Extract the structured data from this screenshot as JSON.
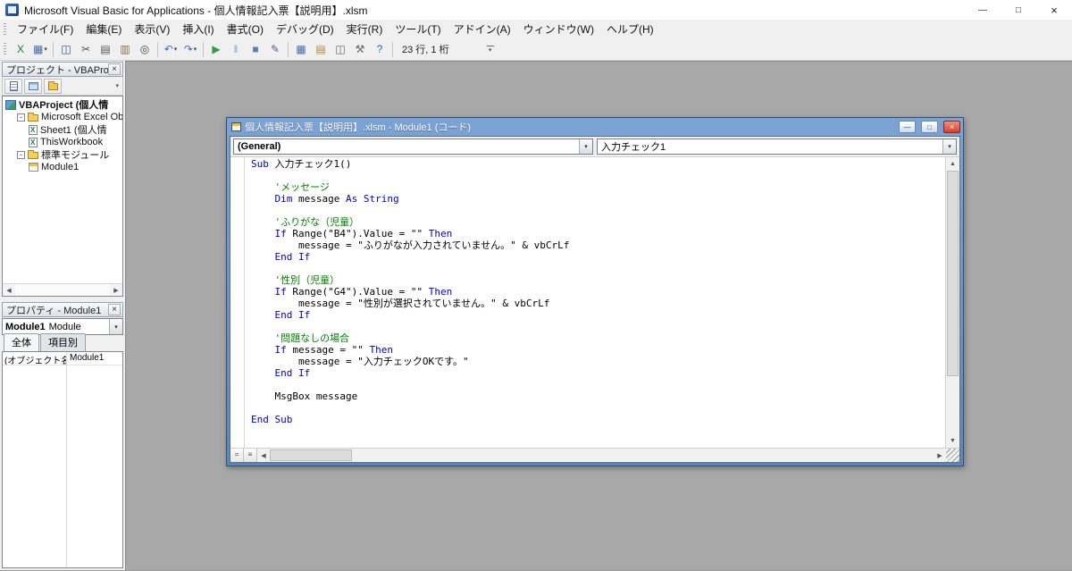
{
  "window": {
    "title": "Microsoft Visual Basic for Applications - 個人情報記入票【説明用】.xlsm"
  },
  "glyphs": {
    "minimize": "—",
    "maximize": "□",
    "close": "×",
    "chevron_down": "▾",
    "up": "▲",
    "down": "▼",
    "left": "◀",
    "right": "▶",
    "proc_view": "=",
    "full_view": "≡"
  },
  "menu": {
    "items": [
      "ファイル(F)",
      "編集(E)",
      "表示(V)",
      "挿入(I)",
      "書式(O)",
      "デバッグ(D)",
      "実行(R)",
      "ツール(T)",
      "アドイン(A)",
      "ウィンドウ(W)",
      "ヘルプ(H)"
    ]
  },
  "toolbar": {
    "buttons": [
      {
        "name": "view-excel-button",
        "glyph": "X",
        "color": "#1a7a3c"
      },
      {
        "name": "insert-userform-button",
        "glyph": "▦",
        "color": "#4a6ea8",
        "dropdown": true
      },
      {
        "sep": true
      },
      {
        "name": "save-button",
        "glyph": "◫",
        "color": "#2d4f8a"
      },
      {
        "name": "cut-button",
        "glyph": "✂",
        "color": "#555555"
      },
      {
        "name": "copy-button",
        "glyph": "▤",
        "color": "#555555"
      },
      {
        "name": "paste-button",
        "glyph": "▥",
        "color": "#8a7040"
      },
      {
        "name": "find-button",
        "glyph": "◎",
        "color": "#444444"
      },
      {
        "sep": true
      },
      {
        "name": "undo-button",
        "glyph": "↶",
        "color": "#3a6fd8",
        "dropdown": true
      },
      {
        "name": "redo-button",
        "glyph": "↷",
        "color": "#3a6fd8",
        "dropdown": true
      },
      {
        "sep": true
      },
      {
        "name": "run-button",
        "glyph": "▶",
        "color": "#2f9e44"
      },
      {
        "name": "break-button",
        "glyph": "‖",
        "color": "#8aa4c8"
      },
      {
        "name": "reset-button",
        "glyph": "■",
        "color": "#5b7fae"
      },
      {
        "name": "design-mode-button",
        "glyph": "✎",
        "color": "#556688"
      },
      {
        "sep": true
      },
      {
        "name": "project-explorer-button",
        "glyph": "▦",
        "color": "#4a6ea8"
      },
      {
        "name": "properties-window-button",
        "glyph": "▤",
        "color": "#b08830"
      },
      {
        "name": "object-browser-button",
        "glyph": "◫",
        "color": "#666666"
      },
      {
        "name": "toolbox-button",
        "glyph": "⚒",
        "color": "#666666"
      },
      {
        "name": "help-button",
        "glyph": "?",
        "color": "#2a64c8"
      },
      {
        "sep": true
      }
    ],
    "position_indicator": "23 行, 1 桁"
  },
  "project_explorer": {
    "title": "プロジェクト - VBAProject",
    "tree": [
      {
        "id": "vbaproject-root",
        "label": "VBAProject (個人情",
        "icon": "project",
        "bold": true,
        "indent": 0
      },
      {
        "id": "excel-objects-folder",
        "label": "Microsoft Excel Ob",
        "icon": "folder",
        "expander": true,
        "indent": 1
      },
      {
        "id": "sheet1",
        "label": "Sheet1 (個人情",
        "icon": "worksheet",
        "indent": 2
      },
      {
        "id": "thisworkbook",
        "label": "ThisWorkbook",
        "icon": "workbook",
        "indent": 2
      },
      {
        "id": "modules-folder",
        "label": "標準モジュール",
        "icon": "folder",
        "expander": true,
        "indent": 1
      },
      {
        "id": "module1",
        "label": "Module1",
        "icon": "module",
        "indent": 2
      }
    ]
  },
  "properties": {
    "title": "プロパティ - Module1",
    "object_name": "Module1",
    "object_type": "Module",
    "tabs": [
      {
        "label": "全体"
      },
      {
        "label": "項目別"
      }
    ],
    "rows": [
      {
        "name": "(オブジェクト名)",
        "value": "Module1"
      }
    ]
  },
  "code_window": {
    "title": "個人情報記入票【説明用】.xlsm - Module1 (コード)",
    "object_combo": "(General)",
    "procedure_combo": "入力チェック1",
    "lines": [
      [
        {
          "t": "k",
          "s": "Sub"
        },
        {
          "t": "n",
          "s": " 入力チェック1()"
        }
      ],
      [],
      [
        {
          "t": "c",
          "s": "    'メッセージ"
        }
      ],
      [
        {
          "t": "n",
          "s": "    "
        },
        {
          "t": "k",
          "s": "Dim"
        },
        {
          "t": "n",
          "s": " message "
        },
        {
          "t": "k",
          "s": "As String"
        }
      ],
      [],
      [
        {
          "t": "c",
          "s": "    'ふりがな（児童）"
        }
      ],
      [
        {
          "t": "n",
          "s": "    "
        },
        {
          "t": "k",
          "s": "If"
        },
        {
          "t": "n",
          "s": " Range(\"B4\").Value = \"\" "
        },
        {
          "t": "k",
          "s": "Then"
        }
      ],
      [
        {
          "t": "n",
          "s": "        message = \"ふりがなが入力されていません。\" & vbCrLf"
        }
      ],
      [
        {
          "t": "n",
          "s": "    "
        },
        {
          "t": "k",
          "s": "End If"
        }
      ],
      [],
      [
        {
          "t": "c",
          "s": "    '性別（児童）"
        }
      ],
      [
        {
          "t": "n",
          "s": "    "
        },
        {
          "t": "k",
          "s": "If"
        },
        {
          "t": "n",
          "s": " Range(\"G4\").Value = \"\" "
        },
        {
          "t": "k",
          "s": "Then"
        }
      ],
      [
        {
          "t": "n",
          "s": "        message = \"性別が選択されていません。\" & vbCrLf"
        }
      ],
      [
        {
          "t": "n",
          "s": "    "
        },
        {
          "t": "k",
          "s": "End If"
        }
      ],
      [],
      [
        {
          "t": "c",
          "s": "    '問題なしの場合"
        }
      ],
      [
        {
          "t": "n",
          "s": "    "
        },
        {
          "t": "k",
          "s": "If"
        },
        {
          "t": "n",
          "s": " message = \"\" "
        },
        {
          "t": "k",
          "s": "Then"
        }
      ],
      [
        {
          "t": "n",
          "s": "        message = \"入力チェックOKです。\""
        }
      ],
      [
        {
          "t": "n",
          "s": "    "
        },
        {
          "t": "k",
          "s": "End If"
        }
      ],
      [],
      [
        {
          "t": "n",
          "s": "    MsgBox message"
        }
      ],
      [],
      [
        {
          "t": "k",
          "s": "End Sub"
        }
      ]
    ]
  }
}
